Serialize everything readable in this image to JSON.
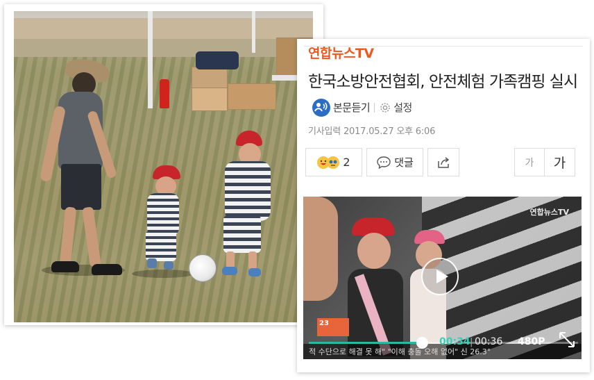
{
  "article": {
    "brand": "연합뉴스TV",
    "headline": "한국소방안전협회, 안전체험 가족캠핑 실시",
    "listen_label": "본문듣기",
    "settings_label": "설정",
    "dateline": "기사입력  2017.05.27 오후 6:06",
    "reaction_count": "2",
    "comment_label": "댓글",
    "font_small_label": "가",
    "font_large_label": "가"
  },
  "video": {
    "brand": "연합뉴스TV",
    "channel_badge": "23",
    "ticker_text": "적 수단으로 해결 못 해\"    \"이해 충돌 오해 없어\"  신  26.3°",
    "current_time": "00:34",
    "total_time": "00:36",
    "quality": "480P",
    "progress": 0.94
  },
  "colors": {
    "brand": "#f0571e",
    "accent": "#2bb7a3",
    "listen_icon": "#2b6cc4"
  },
  "icons": [
    "listen-icon",
    "gear-icon",
    "emoji-icon",
    "comment-icon",
    "share-icon",
    "play-icon",
    "expand-icon"
  ]
}
